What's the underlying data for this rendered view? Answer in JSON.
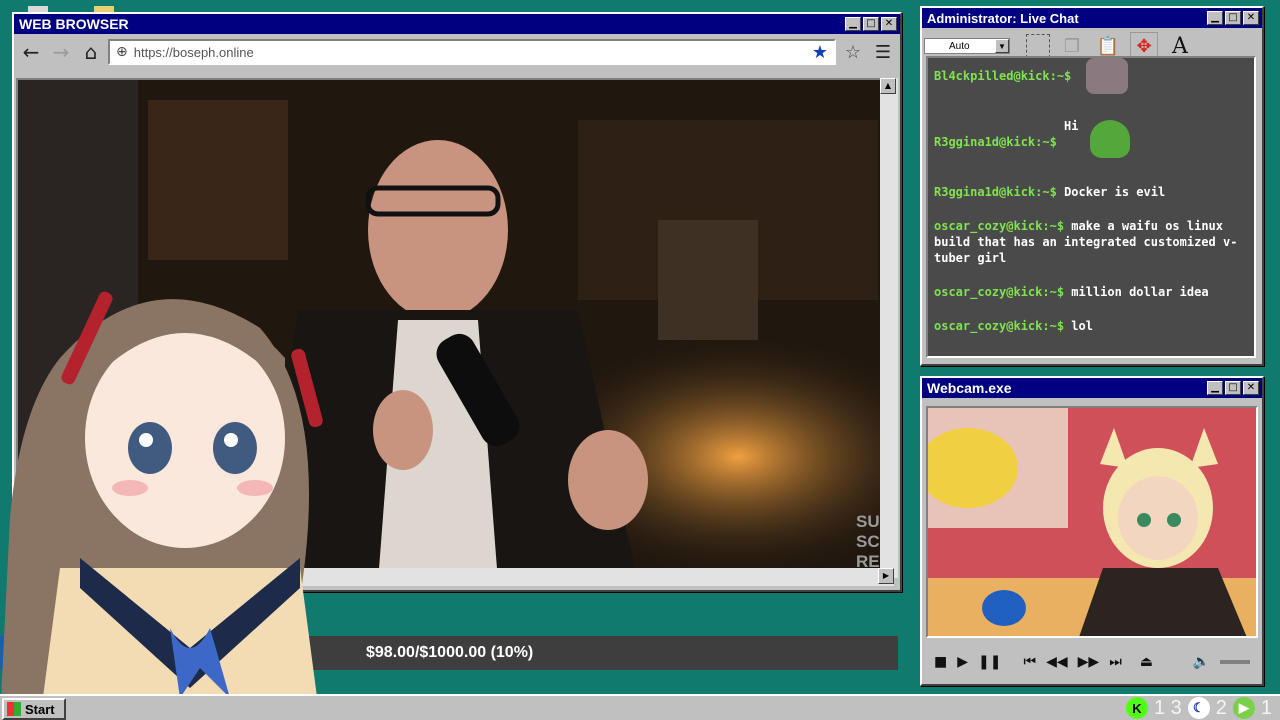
{
  "browser": {
    "title": "WEB BROWSER",
    "url": "https://boseph.online",
    "video_overlay_text": "SU SCRE"
  },
  "chat": {
    "title": "Administrator: Live Chat",
    "font_size_value": "Auto",
    "messages": [
      {
        "user": "Bl4ckpilled@kick:~$",
        "text": ""
      },
      {
        "user": "",
        "text": "Hi"
      },
      {
        "user": "R3ggina1d@kick:~$",
        "text": ""
      },
      {
        "user": "R3ggina1d@kick:~$",
        "text": "Docker is evil"
      },
      {
        "user": "oscar_cozy@kick:~$",
        "text": "make a waifu os linux build that has an integrated customized v-tuber girl"
      },
      {
        "user": "oscar_cozy@kick:~$",
        "text": "million dollar idea"
      },
      {
        "user": "oscar_cozy@kick:~$",
        "text": "lol"
      }
    ]
  },
  "webcam": {
    "title": "Webcam.exe"
  },
  "donation": {
    "label": "$98.00/$1000.00 (10%)",
    "fraction": 0.098
  },
  "taskbar": {
    "start_label": "Start",
    "tray": [
      {
        "icon": "kick-icon",
        "value": "1 3"
      },
      {
        "icon": "moon-icon",
        "value": "2"
      },
      {
        "icon": "play-icon",
        "value": "1"
      }
    ]
  },
  "colors": {
    "desktop": "#107a6e",
    "titlebar": "#000080",
    "chat_user": "#7fe34f",
    "progress_fill": "#1a5fa8"
  }
}
